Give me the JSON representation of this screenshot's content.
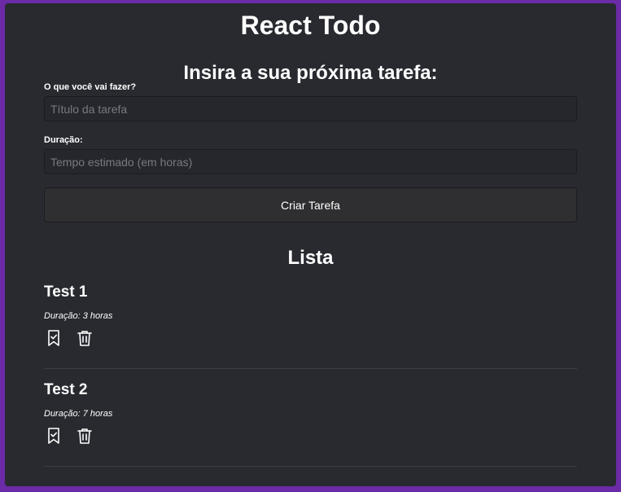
{
  "app": {
    "title": "React Todo"
  },
  "form": {
    "heading": "Insira a sua próxima tarefa:",
    "title_label": "O que você vai fazer?",
    "title_placeholder": "Título da tarefa",
    "title_value": "",
    "duration_label": "Duração:",
    "duration_placeholder": "Tempo estimado (em horas)",
    "duration_value": "",
    "submit_label": "Criar Tarefa"
  },
  "list": {
    "heading": "Lista",
    "tasks": [
      {
        "title": "Test 1",
        "duration": "Duração: 3 horas"
      },
      {
        "title": "Test 2",
        "duration": "Duração: 7 horas"
      }
    ]
  },
  "colors": {
    "frame": "#6b2aa6",
    "panel": "#282a30",
    "text": "#ffffff"
  },
  "icons": [
    "bookmark-check-icon",
    "trash-icon"
  ]
}
